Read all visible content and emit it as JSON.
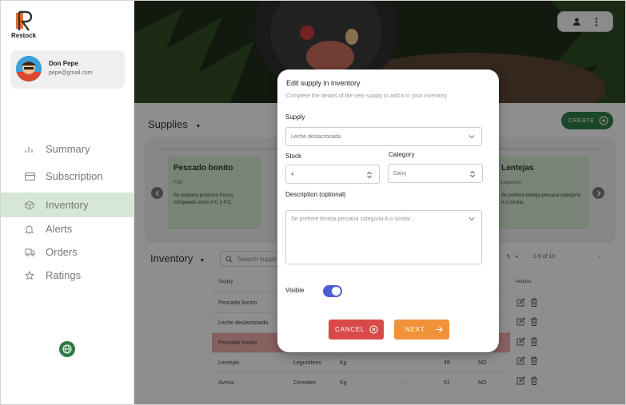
{
  "app": {
    "name": "Restock"
  },
  "profile": {
    "name": "Don Pepe",
    "email": "pepe@gmail.com"
  },
  "sidebar": {
    "items": [
      {
        "label": "Summary",
        "icon": "bar-chart-icon"
      },
      {
        "label": "Subscription",
        "icon": "credit-card-icon"
      },
      {
        "label": "Inventory",
        "icon": "box-icon",
        "active": true
      },
      {
        "label": "Alerts",
        "icon": "bell-icon"
      },
      {
        "label": "Orders",
        "icon": "truck-icon"
      },
      {
        "label": "Ratings",
        "icon": "star-icon"
      }
    ]
  },
  "supplies": {
    "title": "Supplies",
    "create_label": "CREATE",
    "cards": [
      {
        "title": "Pescado bonito",
        "category": "Fish",
        "description": "Se requiere producto fresco, refrigerado entre 0°C y 4°C"
      },
      {
        "title": "Lentejas",
        "category": "Legumes",
        "description": "Se prefiere lenteja peruana categoría A o similar."
      }
    ]
  },
  "inventory": {
    "title": "Inventory",
    "search_placeholder": "Search suppli",
    "rows_per_page": "5",
    "range": "1-5 of 10",
    "columns": {
      "supply": "Supply",
      "actions": "Actions"
    },
    "rows": [
      {
        "supply": "Pescado bonito",
        "category": "",
        "unit": "",
        "dash": "",
        "qty": "",
        "flag": "",
        "highlight": false
      },
      {
        "supply": "Leche deslactosada",
        "category": "",
        "unit": "",
        "dash": "",
        "qty": "",
        "flag": "",
        "highlight": false
      },
      {
        "supply": "Pescado bonito",
        "category": "",
        "unit": "",
        "dash": "",
        "qty": "",
        "flag": "",
        "highlight": true
      },
      {
        "supply": "Lentejas",
        "category": "Legumbres",
        "unit": "Kg",
        "dash": "-",
        "qty": "49",
        "flag": "NO",
        "highlight": false
      },
      {
        "supply": "Avena",
        "category": "Cereales",
        "unit": "Kg",
        "dash": "-",
        "qty": "51",
        "flag": "NO",
        "highlight": false
      }
    ]
  },
  "modal": {
    "title": "Edit supply in inventory",
    "subtitle": "Complete the details of the new supply to add it to your inventory.",
    "supply_label": "Supply",
    "supply_value": "Leche deslactosada",
    "stock_label": "Stock",
    "stock_value": "4",
    "category_label": "Category",
    "category_value": "Dairy",
    "description_label": "Description (optional)",
    "description_placeholder": "Se prefiere lenteja peruana categoría A o similar...",
    "visible_label": "Visible",
    "cancel_label": "CANCEL",
    "next_label": "NEXT"
  },
  "colors": {
    "green": "#2f7a45",
    "card": "#cfe3cc",
    "cancel": "#d84a4a",
    "next": "#f0923a",
    "toggle": "#4b5cd6",
    "highlight": "#e8a6a6"
  }
}
